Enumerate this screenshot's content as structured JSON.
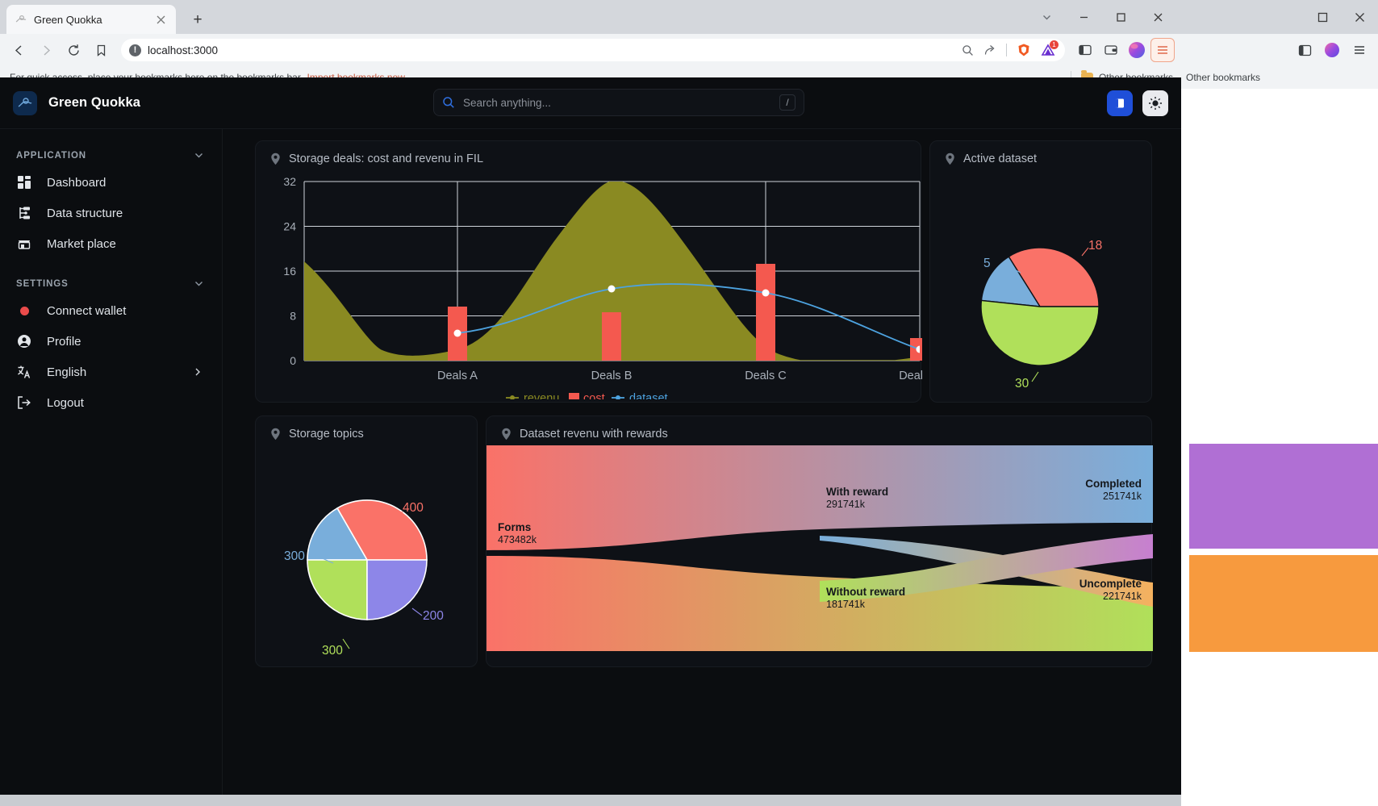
{
  "browser": {
    "tab": {
      "title": "Green Quokka",
      "close_label": "×"
    },
    "new_tab_label": "+",
    "window_controls": {
      "list": "⌄",
      "minimize": "–",
      "maximize": "□",
      "close": "×"
    },
    "omnibox": {
      "url": "localhost:3000",
      "info_glyph": "!"
    },
    "extension_badge": "1",
    "bookmarks_bar": {
      "text": "For quick access, place your bookmarks here on the bookmarks bar.",
      "link": "Import bookmarks now...",
      "other_bookmarks": "Other bookmarks"
    },
    "background_window": {
      "other_bookmarks": "Other bookmarks"
    }
  },
  "app": {
    "brand": "Green Quokka",
    "search": {
      "placeholder": "Search anything...",
      "shortcut": "/"
    },
    "sidebar": {
      "groups": [
        {
          "label": "APPLICATION",
          "items": [
            {
              "label": "Dashboard",
              "icon": "dashboard-icon"
            },
            {
              "label": "Data structure",
              "icon": "data-structure-icon"
            },
            {
              "label": "Market place",
              "icon": "market-place-icon"
            }
          ]
        },
        {
          "label": "SETTINGS",
          "items": [
            {
              "label": "Connect wallet",
              "icon": "wallet-status-icon"
            },
            {
              "label": "Profile",
              "icon": "profile-icon"
            },
            {
              "label": "English",
              "icon": "language-icon"
            },
            {
              "label": "Logout",
              "icon": "logout-icon"
            }
          ]
        }
      ]
    },
    "cards": {
      "deals": {
        "title": "Storage deals: cost and revenu in FIL"
      },
      "active": {
        "title": "Active dataset"
      },
      "topics": {
        "title": "Storage topics"
      },
      "sankey": {
        "title": "Dataset revenu with rewards"
      }
    }
  },
  "colors": {
    "revenu": "#8a8a22",
    "cost": "#f4594f",
    "dataset": "#4da3e0",
    "pie_red": "#fa7268",
    "pie_green": "#b0e05a",
    "pie_blue": "#79aedb",
    "pie_purple": "#8d86e8",
    "accent_blue": "#1f4fd8",
    "bg": "#0b0d10",
    "card_bg": "#0e1116"
  },
  "chart_data": [
    {
      "type": "bar",
      "id": "storage-deals",
      "title": "Storage deals: cost and revenu in FIL",
      "categories": [
        "Deals A",
        "Deals B",
        "Deals C",
        "Deals D"
      ],
      "ylim": [
        0,
        32
      ],
      "yticks": [
        0,
        8,
        16,
        24,
        32
      ],
      "grid": true,
      "legend_position": "bottom",
      "series": [
        {
          "name": "revenu",
          "type": "area",
          "values": [
            17.5,
            1.8,
            30.8,
            0.6
          ],
          "color": "#8a8a22"
        },
        {
          "name": "cost",
          "type": "bar",
          "values": [
            9.6,
            8.6,
            17.3,
            4.0
          ],
          "color": "#f4594f"
        },
        {
          "name": "dataset",
          "type": "line",
          "values": [
            4.8,
            11.6,
            12.1,
            2.6
          ],
          "color": "#4da3e0"
        }
      ]
    },
    {
      "type": "pie",
      "id": "active-dataset",
      "title": "Active dataset",
      "labels": [
        "18",
        "5",
        "30"
      ],
      "values": [
        18,
        5,
        30
      ],
      "colors": [
        "#fa7268",
        "#79aedb",
        "#b0e05a"
      ]
    },
    {
      "type": "pie",
      "id": "storage-topics",
      "title": "Storage topics",
      "labels": [
        "400",
        "300",
        "300",
        "200"
      ],
      "values": [
        400,
        300,
        300,
        200
      ],
      "colors": [
        "#fa7268",
        "#79aedb",
        "#b0e05a",
        "#8d86e8"
      ]
    },
    {
      "type": "sankey",
      "id": "dataset-revenu-rewards",
      "title": "Dataset revenu with rewards",
      "nodes": [
        {
          "name": "Forms",
          "value": "473482k"
        },
        {
          "name": "With reward",
          "value": "291741k"
        },
        {
          "name": "Without reward",
          "value": "181741k"
        },
        {
          "name": "Completed",
          "value": "251741k"
        },
        {
          "name": "Uncomplete",
          "value": "221741k"
        }
      ]
    }
  ]
}
